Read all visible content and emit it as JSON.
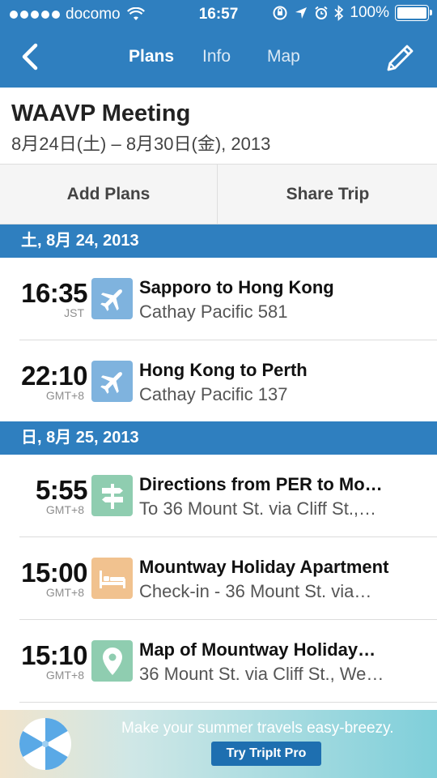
{
  "status_bar": {
    "carrier": "docomo",
    "time": "16:57",
    "battery": "100%"
  },
  "nav": {
    "tabs": [
      {
        "label": "Plans"
      },
      {
        "label": "Info"
      },
      {
        "label": "Map"
      }
    ]
  },
  "trip": {
    "title": "WAAVP Meeting",
    "dates": "8月24日(土) – 8月30日(金), 2013"
  },
  "actions": {
    "add_plans": "Add Plans",
    "share_trip": "Share Trip"
  },
  "days": [
    {
      "header": "土, 8月 24, 2013",
      "events": [
        {
          "time": "16:35",
          "tz": "JST",
          "icon": "airplane-icon",
          "title": "Sapporo to Hong Kong",
          "subtitle": "Cathay Pacific 581"
        },
        {
          "time": "22:10",
          "tz": "GMT+8",
          "icon": "airplane-icon",
          "title": "Hong Kong to Perth",
          "subtitle": "Cathay Pacific 137"
        }
      ]
    },
    {
      "header": "日, 8月 25, 2013",
      "events": [
        {
          "time": "5:55",
          "tz": "GMT+8",
          "icon": "signpost-icon",
          "title": "Directions from PER to Mo…",
          "subtitle": "To 36 Mount St. via Cliff St.,…"
        },
        {
          "time": "15:00",
          "tz": "GMT+8",
          "icon": "bed-icon",
          "title": "Mountway Holiday Apartment",
          "subtitle": "Check-in - 36 Mount St. via…"
        },
        {
          "time": "15:10",
          "tz": "GMT+8",
          "icon": "map-pin-icon",
          "title": "Map of Mountway Holiday…",
          "subtitle": "36 Mount St. via Cliff St., We…"
        }
      ]
    }
  ],
  "ad": {
    "text": "Make your summer travels easy-breezy.",
    "button": "Try TripIt Pro"
  },
  "colors": {
    "brand_blue": "#2f7fbf",
    "icon_blue": "#7fb3de",
    "icon_green": "#8fcdb0",
    "icon_orange": "#f1c28f"
  }
}
